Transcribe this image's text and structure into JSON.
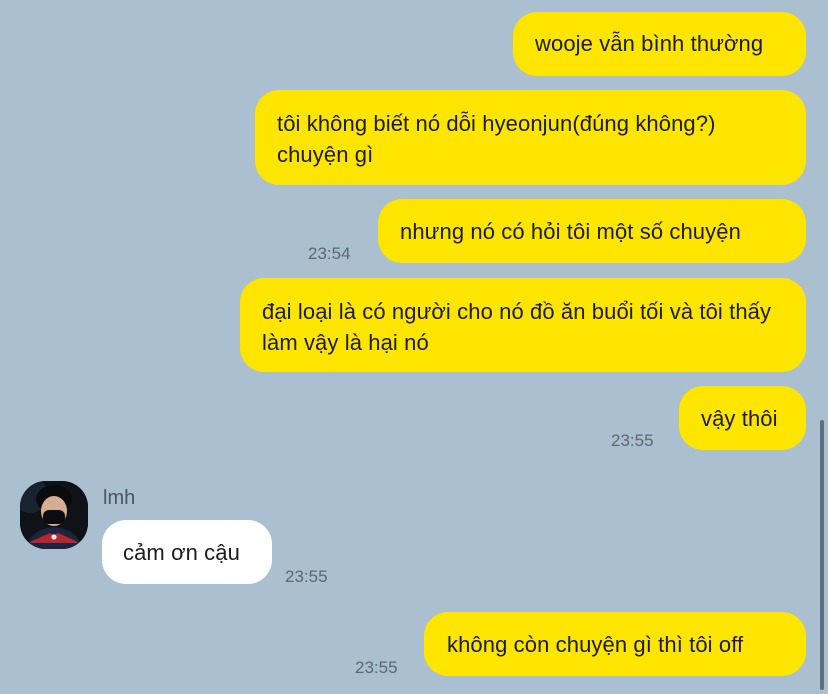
{
  "messages": [
    {
      "text": "wooje vẫn bình thường"
    },
    {
      "text": "tôi không biết nó dỗi hyeonjun(đúng không?) chuyện gì"
    },
    {
      "text": "nhưng nó có hỏi tôi một số chuyện",
      "time": "23:54"
    },
    {
      "text": "đại loại là có người cho nó đồ ăn buổi tối và tôi thấy làm vậy là hại nó"
    },
    {
      "text": "vậy thôi",
      "time": "23:55"
    },
    {
      "sender": "lmh",
      "text": "cảm ơn cậu",
      "time": "23:55"
    },
    {
      "text": "không còn chuyện gì thì tôi off",
      "time": "23:55"
    }
  ],
  "colors": {
    "background": "#aabfd0",
    "outgoing_bubble": "#fee500",
    "incoming_bubble": "#ffffff"
  },
  "icons": {
    "avatar": "avatar-icon"
  }
}
